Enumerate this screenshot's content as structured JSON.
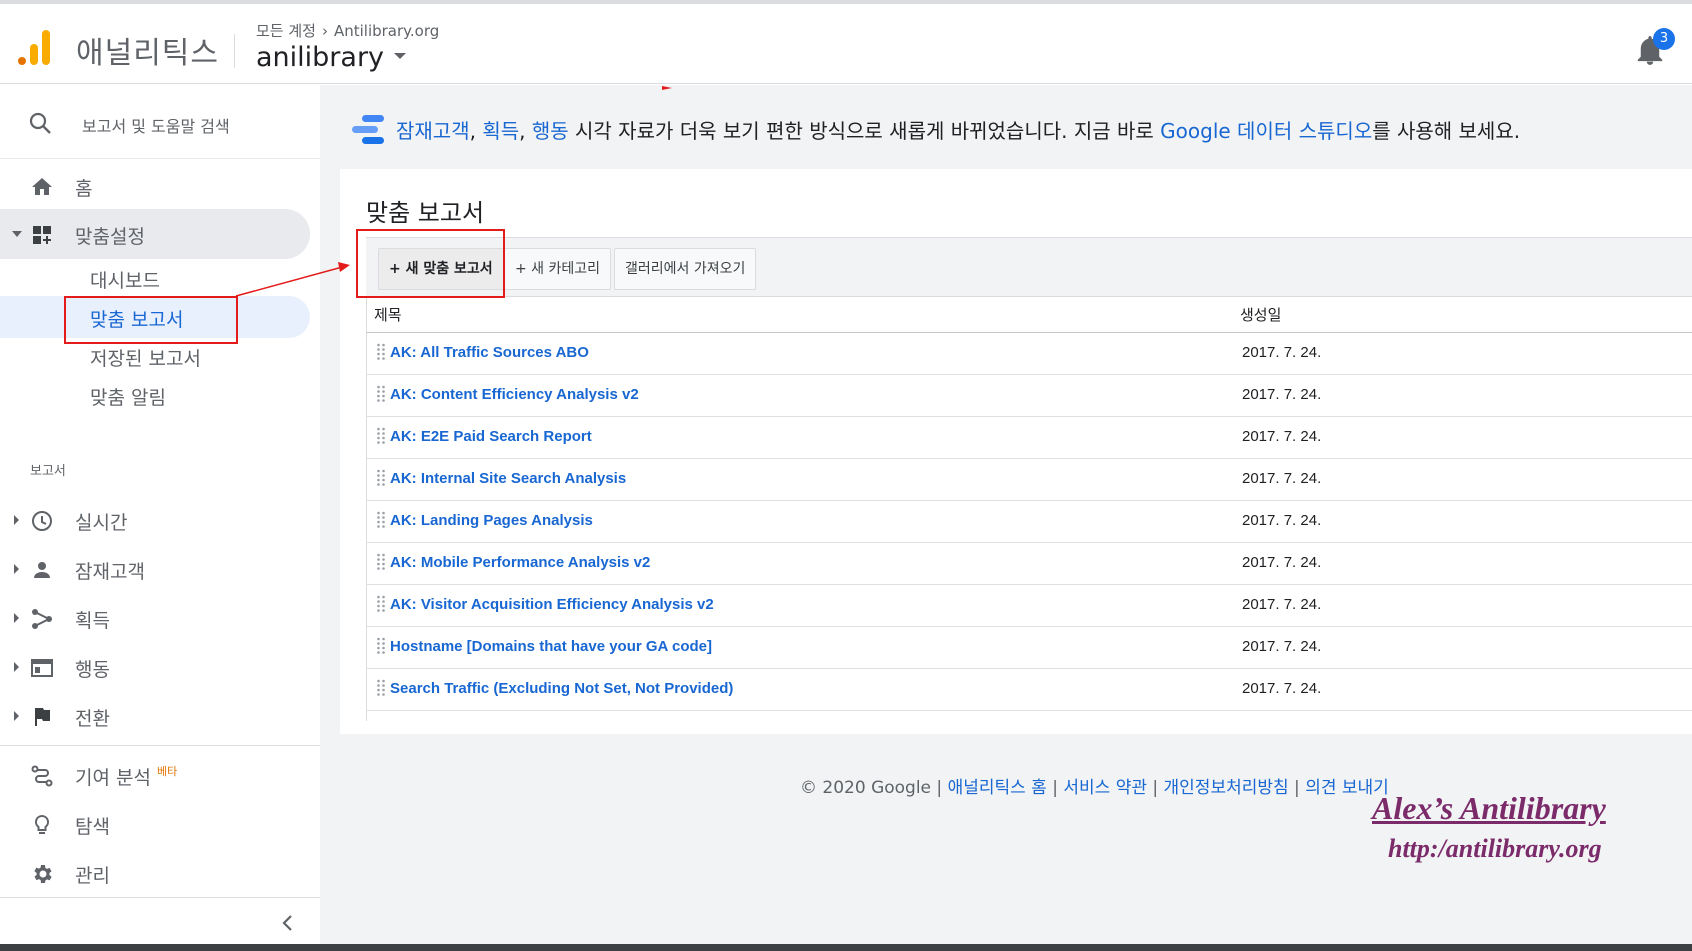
{
  "header": {
    "product_name": "애널리틱스",
    "breadcrumb": {
      "root": "모든 계정",
      "account": "Antilibrary.org"
    },
    "property_name": "anilibrary",
    "notification_count": "3"
  },
  "sidebar": {
    "search_placeholder": "보고서 및 도움말 검색",
    "home": "홈",
    "customization": "맞춤설정",
    "sub_items": [
      "대시보드",
      "맞춤 보고서",
      "저장된 보고서",
      "맞춤 알림"
    ],
    "reports_section": "보고서",
    "reports": [
      "실시간",
      "잠재고객",
      "획득",
      "행동",
      "전환"
    ],
    "attribution": "기여 분석",
    "beta_badge": "베타",
    "discover": "탐색",
    "admin": "관리"
  },
  "banner": {
    "link1": "잠재고객",
    "sep1": ", ",
    "link2": "획득",
    "sep2": ", ",
    "link3": "행동",
    "text_mid": " 시각 자료가 더욱 보기 편한 방식으로 새롭게 바뀌었습니다. 지금 바로 ",
    "link4": "Google 데이터 스튜디오",
    "text_end": "를 사용해 보세요."
  },
  "page": {
    "title": "맞춤 보고서",
    "toolbar": {
      "new_report": "+ 새 맞춤 보고서",
      "new_category": "+ 새 카테고리",
      "import_gallery": "갤러리에서 가져오기"
    },
    "table": {
      "col_title": "제목",
      "col_created": "생성일",
      "rows": [
        {
          "name": "AK: All Traffic Sources ABO",
          "date": "2017. 7. 24."
        },
        {
          "name": "AK: Content Efficiency Analysis v2",
          "date": "2017. 7. 24."
        },
        {
          "name": "AK: E2E Paid Search Report",
          "date": "2017. 7. 24."
        },
        {
          "name": "AK: Internal Site Search Analysis",
          "date": "2017. 7. 24."
        },
        {
          "name": "AK: Landing Pages Analysis",
          "date": "2017. 7. 24."
        },
        {
          "name": "AK: Mobile Performance Analysis v2",
          "date": "2017. 7. 24."
        },
        {
          "name": "AK: Visitor Acquisition Efficiency Analysis v2",
          "date": "2017. 7. 24."
        },
        {
          "name": "Hostname [Domains that have your GA code]",
          "date": "2017. 7. 24."
        },
        {
          "name": "Search Traffic (Excluding Not Set, Not Provided)",
          "date": "2017. 7. 24."
        }
      ]
    }
  },
  "footer": {
    "copyright": "© 2020 Google",
    "sep": " | ",
    "links": [
      "애널리틱스 홈",
      "서비스 약관",
      "개인정보처리방침",
      "의견 보내기"
    ]
  },
  "watermark": {
    "line1": "Alex’s Antilibrary",
    "line2": "http:/antilibrary.org"
  },
  "colors": {
    "accent_blue": "#1967d2",
    "annotation_red": "#e31b1b",
    "logo_orange": "#f9ab00",
    "logo_dark_orange": "#e37400"
  }
}
